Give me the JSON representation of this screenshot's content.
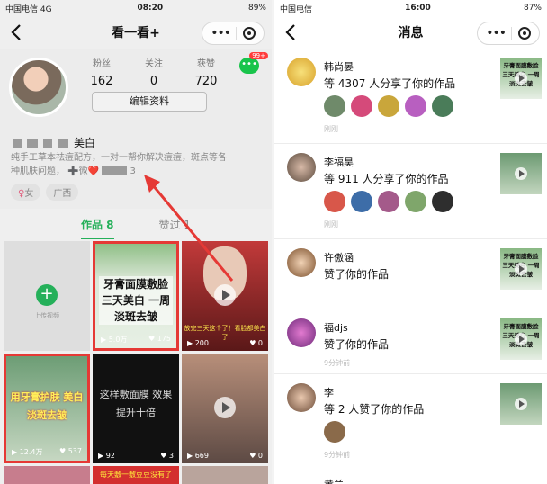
{
  "left": {
    "status": {
      "carrier": "中国电信",
      "network": "4G",
      "time": "08:20",
      "battery": "89%"
    },
    "title": "看一看+",
    "profile": {
      "stats": [
        {
          "label": "粉丝",
          "value": "162"
        },
        {
          "label": "关注",
          "value": "0"
        },
        {
          "label": "获赞",
          "value": "720"
        }
      ],
      "msg_badge": "99+",
      "edit_button": "编辑资料",
      "name_suffix": "美白",
      "bio": "纯手工草本祛痘配方，一对一帮你解决痘痘，斑点等各种肌肤问题，",
      "bio_tail": "➕微❤️",
      "bio_num": "3",
      "tags": [
        "女",
        "广西"
      ]
    },
    "tabs": {
      "works": "作品 8",
      "likes": "赞过 1"
    },
    "upload_label": "上传视频",
    "videos": [
      {
        "text": "牙膏面膜敷脸 三天美白 一周淡斑去皱",
        "plays": "5.0万",
        "likes": "175"
      },
      {
        "text": "放完三天这个了！看脸都美白了",
        "plays": "200",
        "likes": "0"
      },
      {
        "text": "用牙膏护肤 美白淡斑去皱",
        "plays": "12.4万",
        "likes": "537"
      },
      {
        "text": "这样敷面膜 效果提升十倍",
        "plays": "92",
        "likes": "3"
      },
      {
        "text": "",
        "plays": "669",
        "likes": "0"
      }
    ],
    "bottom_text": "每天敷一敷豆豆没有了"
  },
  "right": {
    "status": {
      "carrier": "中国电信",
      "time": "16:00",
      "battery": "87%"
    },
    "title": "消息",
    "messages": [
      {
        "name": "韩尚晏",
        "action": "等 4307 人分享了你的作品",
        "time": "刚刚",
        "thumb": "牙膏面膜敷脸 三天美白 一周淡斑去皱"
      },
      {
        "name": "李福昊",
        "action": "等 911 人分享了你的作品",
        "time": "刚刚",
        "thumb": ""
      },
      {
        "name": "许傲涵",
        "action": "赞了你的作品",
        "time": "",
        "thumb": "牙膏面膜敷脸 三天美白 一周淡斑去皱"
      },
      {
        "name": "福djs",
        "action": "赞了你的作品",
        "time": "9分钟前",
        "thumb": "牙膏面膜敷脸 三天美白 一周淡斑去皱"
      },
      {
        "name": "李",
        "action": "等 2 人赞了你的作品",
        "time": "9分钟前",
        "thumb": ""
      }
    ],
    "partial_name": "黄兰"
  }
}
